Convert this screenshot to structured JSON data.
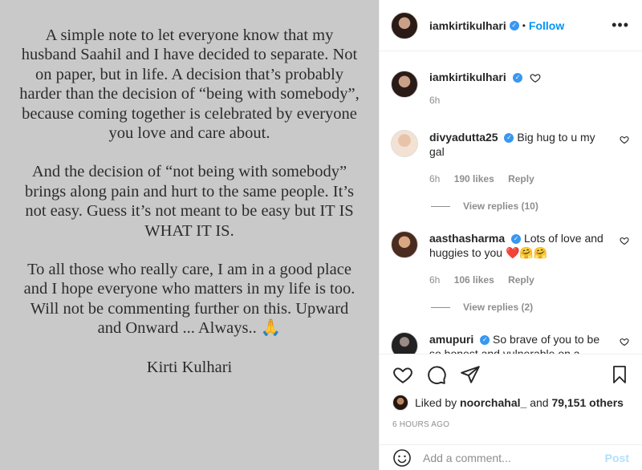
{
  "image": {
    "paragraphs": [
      "A simple note to let everyone know that my husband Saahil and I have decided to separate. Not on paper, but in life.  A decision that’s probably harder than the decision of “being with somebody”,  because coming together is celebrated by everyone you love and care about.",
      "And the decision of “not being with somebody” brings along pain and hurt to the same people. It’s not easy. Guess it’s not meant to be easy but IT IS WHAT IT IS.",
      "To all those who really care, I am in a good place and I hope everyone who matters in my life is too. Will not be commenting further on this. Upward and Onward ... Always.. 🙏"
    ],
    "signature": "Kirti Kulhari"
  },
  "header": {
    "username": "iamkirtikulhari",
    "follow_label": "Follow",
    "dot": "•"
  },
  "caption": {
    "username": "iamkirtikulhari",
    "time": "6h"
  },
  "comments": [
    {
      "username": "divyadutta25",
      "text": "Big hug to u my gal",
      "time": "6h",
      "likes": "190 likes",
      "reply": "Reply",
      "view_replies": "View replies (10)"
    },
    {
      "username": "aasthasharma",
      "text": "Lots of love and huggies to you ❤️🤗🤗",
      "time": "6h",
      "likes": "106 likes",
      "reply": "Reply",
      "view_replies": "View replies (2)"
    },
    {
      "username": "amupuri",
      "text": "So brave of you to be so honest and vulnerable on a"
    }
  ],
  "likes": {
    "prefix": "Liked by ",
    "user": "noorchahal_",
    "middle": " and ",
    "count": "79,151 others"
  },
  "time_ago": "6 HOURS AGO",
  "add_comment": {
    "placeholder": "Add a comment...",
    "post_label": "Post"
  },
  "colors": {
    "accent": "#0095f6",
    "verified": "#3897f0",
    "image_bg": "#c9c9c9"
  }
}
